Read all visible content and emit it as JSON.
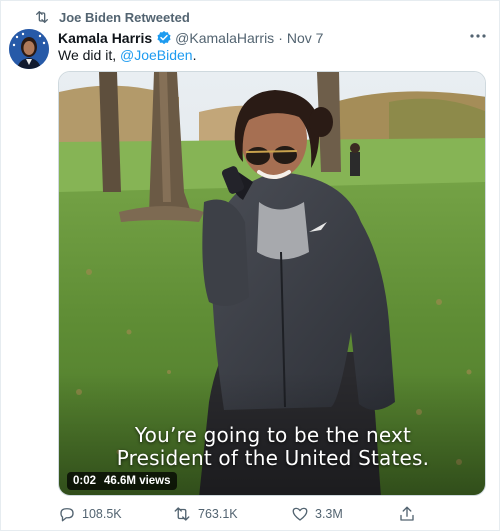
{
  "retweet_header": {
    "text": "Joe Biden Retweeted"
  },
  "author": {
    "display_name": "Kamala Harris",
    "handle": "@KamalaHarris",
    "separator": "·",
    "date": "Nov 7",
    "verified": true
  },
  "tweet": {
    "text_prefix": "We did it, ",
    "mention": "@JoeBiden",
    "text_suffix": "."
  },
  "media": {
    "caption_line1": "You’re going to be the next",
    "caption_line2": "President of the United States.",
    "timestamp": "0:02",
    "views": "46.6M views"
  },
  "actions": {
    "replies": "108.5K",
    "retweets": "763.1K",
    "likes": "3.3M"
  },
  "colors": {
    "link": "#1d9bf0",
    "muted_text": "#536471",
    "primary_text": "#0f1419",
    "border": "#e6ecf0"
  },
  "icons": {
    "retweet_header": "retweet-icon",
    "verified": "verified-badge-icon",
    "more": "more-horizontal-icon",
    "reply": "reply-icon",
    "retweet": "retweet-icon",
    "like": "heart-icon",
    "share": "share-icon"
  }
}
